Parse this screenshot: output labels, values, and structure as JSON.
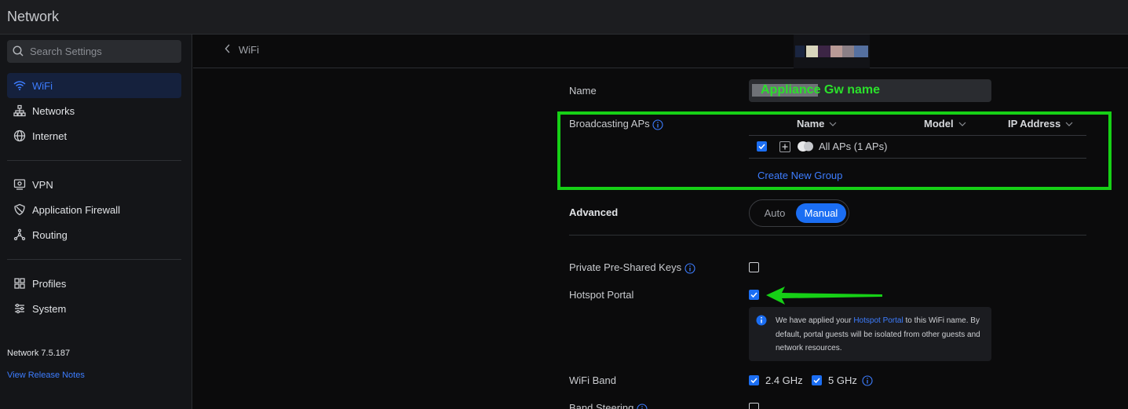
{
  "app": {
    "title": "Network"
  },
  "search": {
    "placeholder": "Search Settings"
  },
  "sidebar": {
    "items": [
      {
        "label": "WiFi",
        "icon": "wifi-icon",
        "active": true
      },
      {
        "label": "Networks",
        "icon": "network-tree-icon"
      },
      {
        "label": "Internet",
        "icon": "globe-icon"
      },
      {
        "label": "VPN",
        "icon": "vpn-icon"
      },
      {
        "label": "Application Firewall",
        "icon": "shield-icon"
      },
      {
        "label": "Routing",
        "icon": "routing-icon"
      },
      {
        "label": "Profiles",
        "icon": "profiles-icon"
      },
      {
        "label": "System",
        "icon": "system-sliders-icon"
      }
    ],
    "version": "Network 7.5.187",
    "release_notes": "View Release Notes"
  },
  "header": {
    "back_label": "WiFi"
  },
  "form": {
    "name_label": "Name",
    "name_annotation": "Appliance Gw name",
    "broadcasting_label": "Broadcasting APs",
    "columns": {
      "name": "Name",
      "model": "Model",
      "ip": "IP Address"
    },
    "ap_group": "All APs (1 APs)",
    "create_group": "Create New Group",
    "advanced_label": "Advanced",
    "advanced_options": {
      "auto": "Auto",
      "manual": "Manual",
      "selected": "Manual"
    },
    "ppsk_label": "Private Pre-Shared Keys",
    "ppsk_checked": false,
    "hotspot_label": "Hotspot Portal",
    "hotspot_checked": true,
    "hotspot_info": {
      "prefix": "We have applied your",
      "link": "Hotspot Portal",
      "suffix": "to this WiFi name. By default, portal guests will be isolated from other guests and network resources."
    },
    "wifi_band_label": "WiFi Band",
    "band_24": "2.4 GHz",
    "band_5": "5 GHz",
    "band_steering_label": "Band Steering"
  },
  "colors": {
    "accent": "#1b6ef3",
    "link": "#3d7dff",
    "annotation_green": "#16d016",
    "sidebar_bg": "#141518",
    "content_bg": "#0b0b0c"
  }
}
